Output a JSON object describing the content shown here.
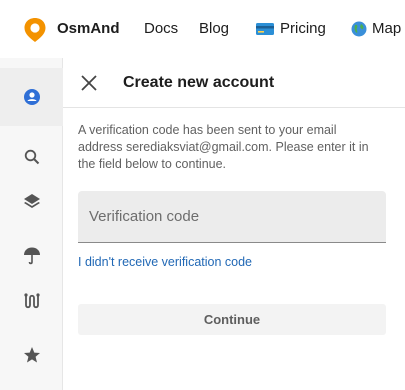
{
  "nav": {
    "brand": "OsmAnd",
    "docs": "Docs",
    "blog": "Blog",
    "pricing": "Pricing",
    "map": "Map"
  },
  "sidebar": {
    "items": [
      {
        "icon": "account-icon",
        "active": true
      },
      {
        "icon": "search-icon"
      },
      {
        "icon": "layers-icon"
      },
      {
        "icon": "weather-umbrella-icon"
      },
      {
        "icon": "route-icon"
      },
      {
        "icon": "favorites-star-icon"
      }
    ]
  },
  "panel": {
    "title": "Create new account",
    "message": "A verification code has been sent to your email address serediaksviat@gmail.com. Please enter it in the field below to continue.",
    "code_placeholder": "Verification code",
    "code_value": "",
    "resend_link": "I didn't receive verification code",
    "continue_label": "Continue"
  },
  "colors": {
    "brand_orange": "#f39200",
    "link_blue": "#2168b5",
    "avatar_blue": "#2f6fd6"
  }
}
